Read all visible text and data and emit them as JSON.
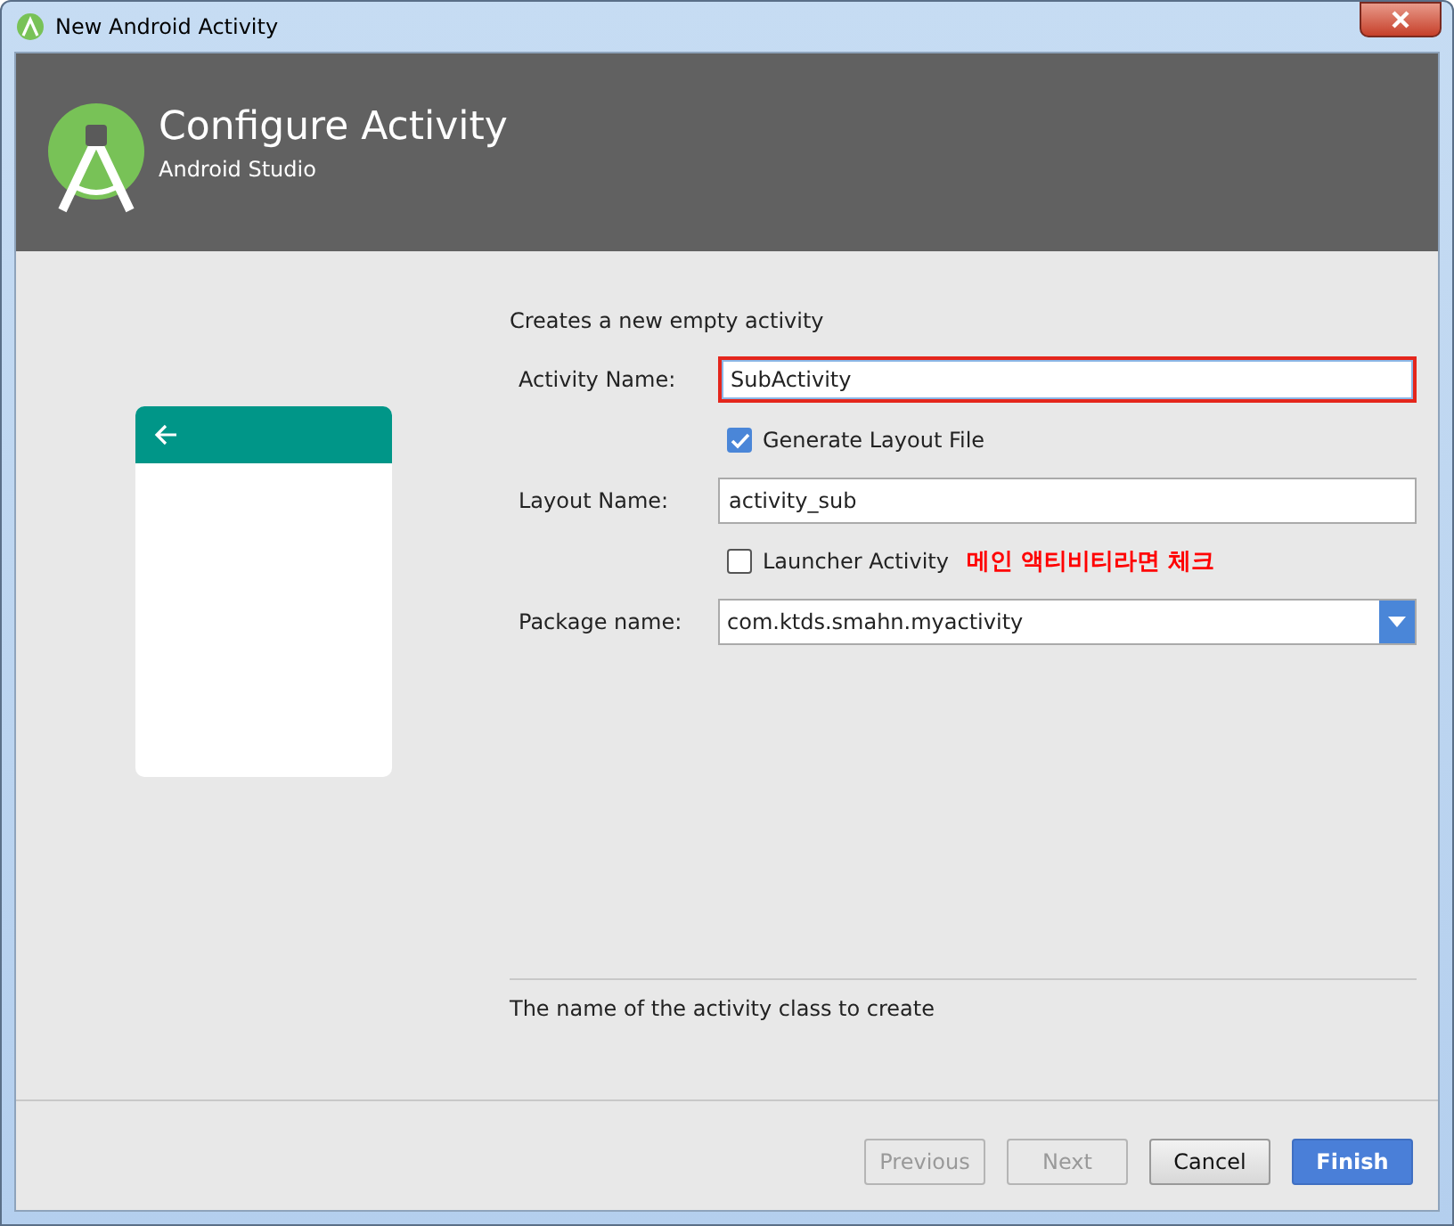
{
  "window": {
    "title": "New Android Activity"
  },
  "header": {
    "title": "Configure Activity",
    "subtitle": "Android Studio"
  },
  "description": "Creates a new empty activity",
  "fields": [
    {
      "kind": "text",
      "label": "Activity Name:",
      "value": "SubActivity",
      "focused": true
    },
    {
      "kind": "checkbox",
      "label": "Generate Layout File",
      "checked": true
    },
    {
      "kind": "text",
      "label": "Layout Name:",
      "value": "activity_sub",
      "focused": false
    },
    {
      "kind": "checkbox",
      "label": "Launcher Activity",
      "checked": false,
      "note": "메인 액티비티라면 체크"
    },
    {
      "kind": "dropdown",
      "label": "Package name:",
      "value": "com.ktds.smahn.myactivity"
    }
  ],
  "help_text": "The name of the activity class to create",
  "buttons": [
    {
      "label": "Previous",
      "disabled": true,
      "primary": false
    },
    {
      "label": "Next",
      "disabled": true,
      "primary": false
    },
    {
      "label": "Cancel",
      "disabled": false,
      "primary": false
    },
    {
      "label": "Finish",
      "disabled": false,
      "primary": true
    }
  ]
}
